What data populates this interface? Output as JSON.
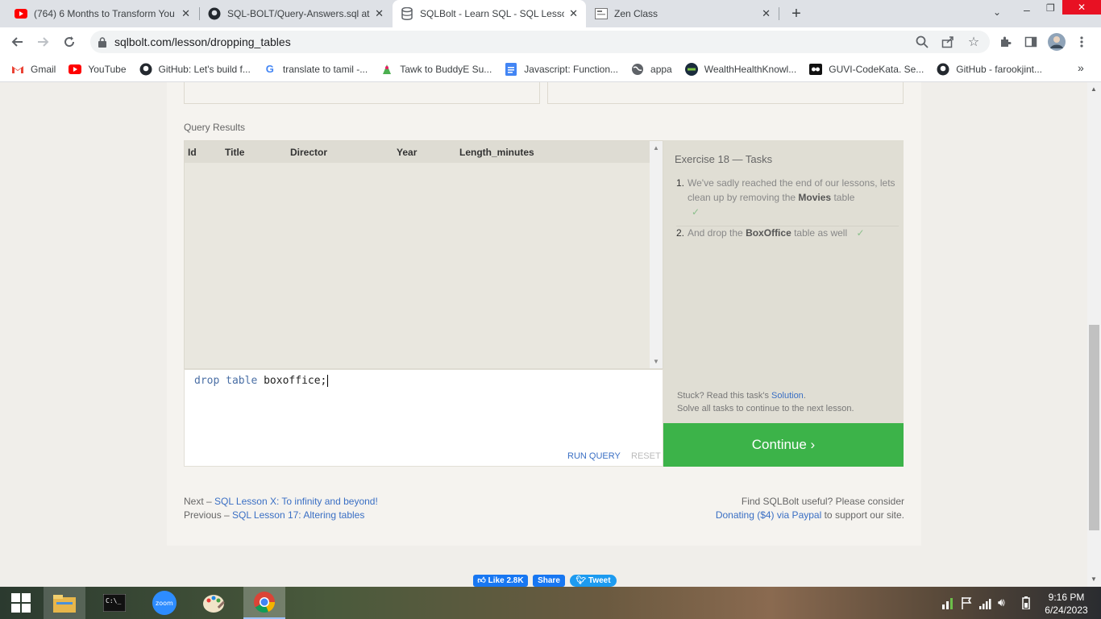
{
  "browser": {
    "tabs": [
      {
        "title": "(764) 6 Months to Transform You",
        "icon": "youtube-icon"
      },
      {
        "title": "SQL-BOLT/Query-Answers.sql at",
        "icon": "github-icon"
      },
      {
        "title": "SQLBolt - Learn SQL - SQL Lesson",
        "icon": "database-icon",
        "active": true
      },
      {
        "title": "Zen Class",
        "icon": "zen-class-icon"
      }
    ],
    "url": "sqlbolt.com/lesson/dropping_tables",
    "bookmarks": [
      {
        "label": "Gmail",
        "icon": "gmail-icon"
      },
      {
        "label": "YouTube",
        "icon": "youtube-icon"
      },
      {
        "label": "GitHub: Let's build f...",
        "icon": "github-icon"
      },
      {
        "label": "translate to tamil -...",
        "icon": "google-icon"
      },
      {
        "label": "Tawk to BuddyE Su...",
        "icon": "tawk-icon"
      },
      {
        "label": "Javascript: Function...",
        "icon": "docs-icon"
      },
      {
        "label": "appa",
        "icon": "globe-icon"
      },
      {
        "label": "WealthHealthKnowl...",
        "icon": "wealth-icon"
      },
      {
        "label": "GUVI-CodeKata. Se...",
        "icon": "guvi-icon"
      },
      {
        "label": "GitHub - farookjint...",
        "icon": "github-icon"
      }
    ],
    "more_bookmarks": "»"
  },
  "page": {
    "query_results_label": "Query Results",
    "columns": [
      "Id",
      "Title",
      "Director",
      "Year",
      "Length_minutes"
    ],
    "editor_keywords": "drop table",
    "editor_ident": "boxoffice;",
    "run_query": "RUN QUERY",
    "reset": "RESET",
    "tasks_title": "Exercise 18 — Tasks",
    "tasks": [
      {
        "num": "1.",
        "pre": "We've sadly reached the end of our lessons, lets clean up by removing the ",
        "bold": "Movies",
        "post": " table",
        "check": "✓"
      },
      {
        "num": "2.",
        "pre": "And drop the ",
        "bold": "BoxOffice",
        "post": " table as well",
        "check": "✓"
      }
    ],
    "stuck_pre": "Stuck? Read this task's ",
    "solution_link": "Solution",
    "stuck_post": ".",
    "solve_all": "Solve all tasks to continue to the next lesson.",
    "continue": "Continue ›",
    "next_pre": "Next – ",
    "next_link": "SQL Lesson X: To infinity and beyond!",
    "prev_pre": "Previous – ",
    "prev_link": "SQL Lesson 17: Altering tables",
    "useful": "Find SQLBolt useful? Please consider",
    "donate_link": "Donating ($4) via Paypal",
    "donate_post": " to support our site.",
    "social": {
      "like": "Like 2.8K",
      "share": "Share",
      "tweet": "Tweet"
    }
  },
  "taskbar": {
    "time": "9:16 PM",
    "date": "6/24/2023",
    "apps": [
      "start-icon",
      "file-explorer-icon",
      "cmd-icon",
      "zoom-icon",
      "paint-icon",
      "chrome-icon"
    ]
  },
  "colors": {
    "continue_green": "#3cb349",
    "link_blue": "#3a6fc4",
    "sql_keyword": "#4a6fa5"
  }
}
